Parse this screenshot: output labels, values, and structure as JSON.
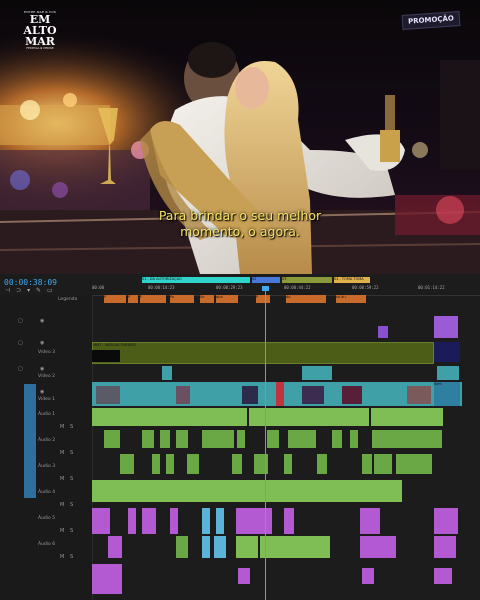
{
  "overlay": {
    "logo_small": "ENTRE MAR & COX",
    "logo_lines": [
      "EM",
      "ALTO",
      "MAR"
    ],
    "logo_sub": "FESTIVAL & CRUISE",
    "promo_sign": "PROMOÇÃO"
  },
  "subtitle": {
    "line1": "Para brindar o seu melhor",
    "line2": "momento, o agora."
  },
  "timeline": {
    "timecode": "00:00:38:09",
    "ruler": [
      "00:00",
      "00:00:14:23",
      "00:00:29:23",
      "00:00:44:22",
      "00:00:59:22",
      "00:01:14:22"
    ],
    "work_tags": [
      "S1 - DÁ AUTORIZAÇÃO",
      "S2",
      "S3",
      "S4 - TOMA TOMA"
    ],
    "video_clip_label": "MIXT - NESCAU FURIOSO",
    "tracks": {
      "captions": "Legenda",
      "v3": "Vídeo 3",
      "v2": "Vídeo 2",
      "v1": "Vídeo 1",
      "a1": "Áudio 1",
      "a2": "Áudio 2",
      "a3": "Áudio 3",
      "a4": "Áudio 4",
      "a5": "Áudio 5",
      "a6": "Áudio 6"
    },
    "caption_clips": [
      "P",
      "P",
      "F",
      "Po",
      "Se",
      "que",
      "P",
      "do",
      "so dri"
    ],
    "v1_tail_label": "Sem"
  },
  "colors": {
    "accent_blue": "#3fa9f5",
    "video_teal": "#3fa0a8",
    "audio_green": "#7fbe54",
    "audio_purple": "#b35ad2",
    "caption_orange": "#c86b2a"
  }
}
